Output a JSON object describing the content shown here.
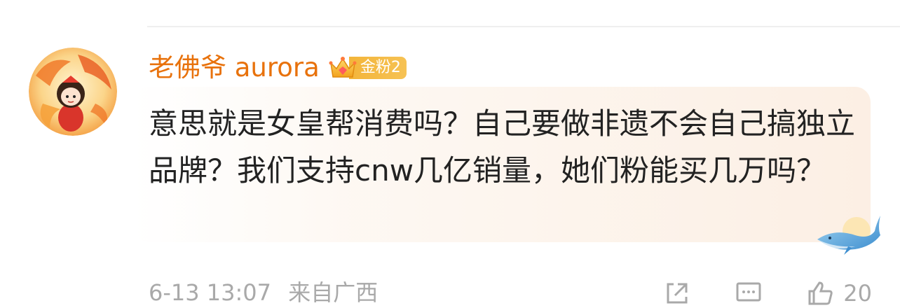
{
  "comment": {
    "username": "老佛爷 aurora",
    "fan_badge": "金粉2",
    "text": "意思就是女皇帮消费吗？自己要做非遗不会自己搞独立品牌？我们支持cnw几亿销量，她们粉能买几万吗？",
    "date": "6-13 13:07",
    "location": "来自广西",
    "like_count": "20"
  },
  "colors": {
    "username": "#e8720c",
    "badge": "#f3b53a",
    "text": "#222222",
    "meta": "#a9a9a9"
  },
  "icons": {
    "avatar": "avatar",
    "badge": "crown-icon",
    "decoration": "whale-icon",
    "share": "share-icon",
    "comment": "comment-icon",
    "like": "thumbs-up-icon"
  }
}
